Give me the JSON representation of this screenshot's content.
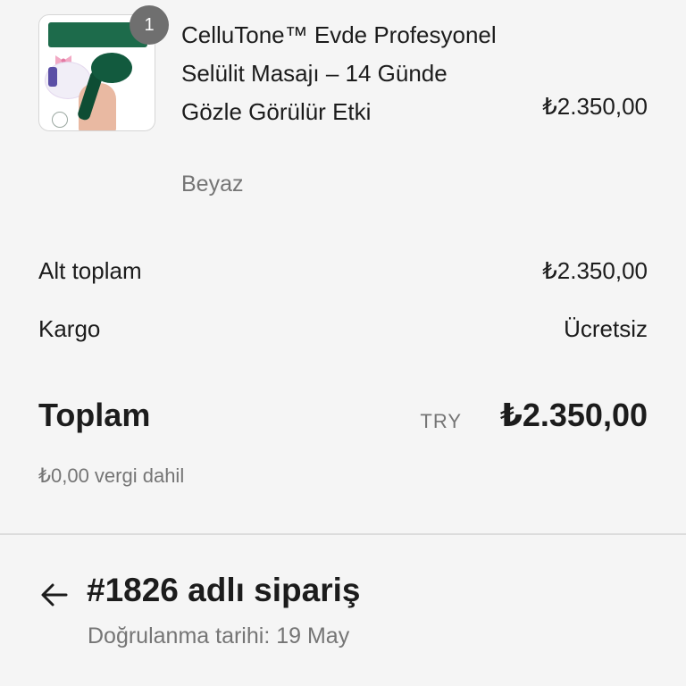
{
  "product": {
    "quantity_badge": "1",
    "title": "CelluTone™ Evde Profesyonel Selülit Masajı – 14 Günde Gözle Görülür Etki",
    "variant": "Beyaz",
    "price": "₺2.350,00",
    "image_icon": "product-image"
  },
  "summary": {
    "subtotal_label": "Alt toplam",
    "subtotal_value": "₺2.350,00",
    "shipping_label": "Kargo",
    "shipping_value": "Ücretsiz",
    "total_label": "Toplam",
    "total_currency": "TRY",
    "total_value": "₺2.350,00",
    "tax_note": "₺0,00 vergi dahil"
  },
  "order": {
    "back_icon": "arrow-left-icon",
    "title": "#1826 adlı sipariş",
    "confirmation_date": "Doğrulanma tarihi: 19 May"
  },
  "colors": {
    "background": "#f5f5f5",
    "text": "#1c1c1c",
    "muted": "#757575",
    "badge": "#6f6f6f"
  }
}
